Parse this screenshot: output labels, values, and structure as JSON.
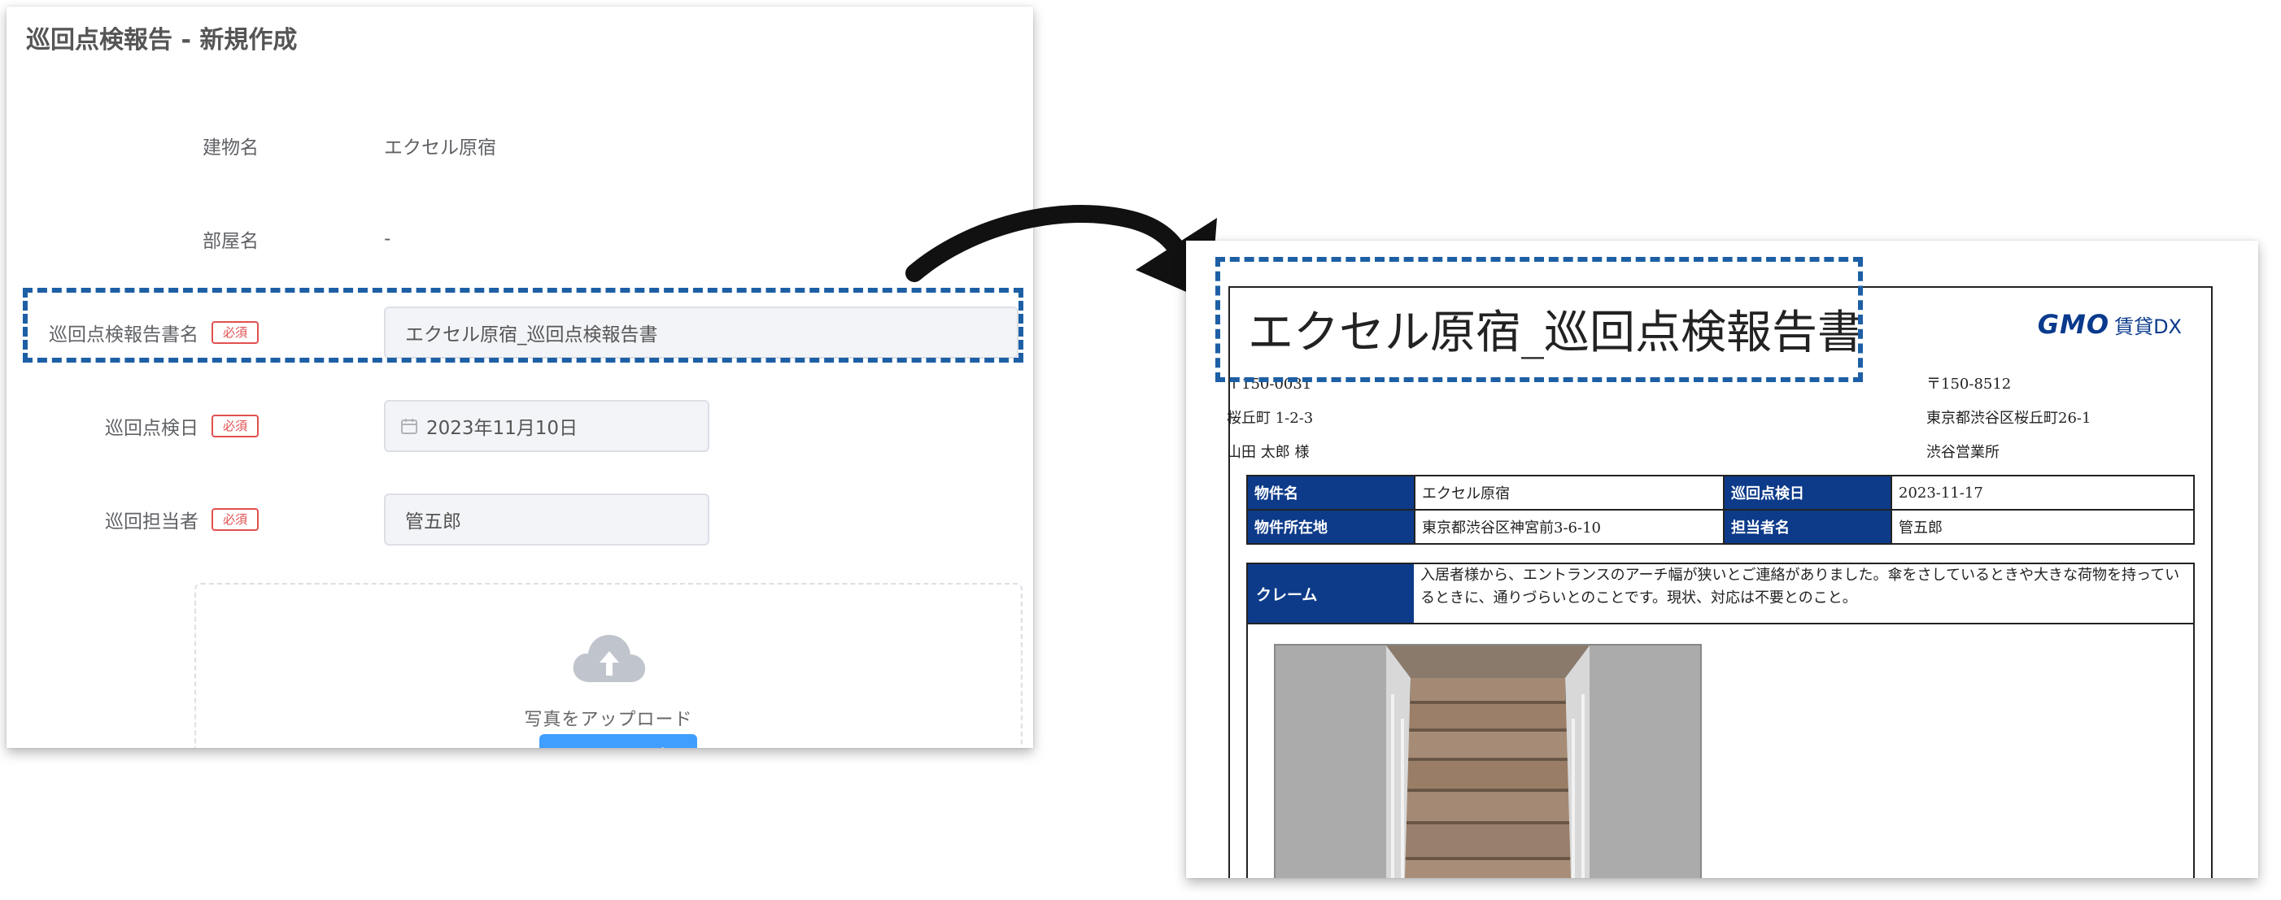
{
  "form": {
    "title": "巡回点検報告 - 新規作成",
    "required_label": "必須",
    "building": {
      "label": "建物名",
      "value": "エクセル原宿"
    },
    "room": {
      "label": "部屋名",
      "value": "-"
    },
    "report_name": {
      "label": "巡回点検報告書名",
      "value": "エクセル原宿_巡回点検報告書"
    },
    "inspection_date": {
      "label": "巡回点検日",
      "value": "2023年11月10日"
    },
    "staff": {
      "label": "巡回担当者",
      "value": "管五郎"
    },
    "upload": {
      "text": "写真をアップロード",
      "button_label": "ファイルを選択"
    }
  },
  "report": {
    "title": "エクセル原宿_巡回点検報告書",
    "logo": {
      "brand": "GMO",
      "service": "賃貸DX"
    },
    "recipient": {
      "postal": "〒150-0031",
      "address": "桜丘町 1-2-3",
      "name": "山田 太郎 様"
    },
    "sender": {
      "postal": "〒150-8512",
      "address": "東京都渋谷区桜丘町26-1",
      "office": "渋谷営業所"
    },
    "table": {
      "property_label": "物件名",
      "property_value": "エクセル原宿",
      "date_label": "巡回点検日",
      "date_value": "2023-11-17",
      "location_label": "物件所在地",
      "location_value": "東京都渋谷区神宮前3-6-10",
      "staff_label": "担当者名",
      "staff_value": "管五郎"
    },
    "claim": {
      "label": "クレーム",
      "text": "入居者様から、エントランスのアーチ幅が狭いとご連絡がありました。傘をさしているときや大きな荷物を持っているときに、通りづらいとのことです。現状、対応は不要とのこと。"
    }
  },
  "colors": {
    "highlight": "#1d5fa5",
    "table_header": "#0d3b8a",
    "required_badge": "#e05050",
    "upload_button": "#409eff"
  },
  "icons": [
    "calendar-icon",
    "cloud-upload-icon",
    "curved-arrow-icon"
  ]
}
